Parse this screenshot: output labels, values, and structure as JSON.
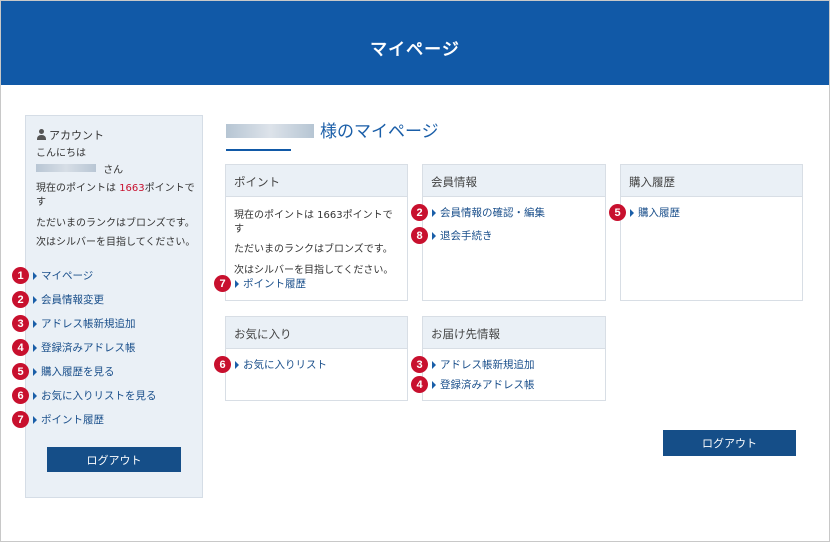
{
  "header": {
    "title": "マイページ"
  },
  "sidebar": {
    "account_label": "アカウント",
    "greeting": "こんにちは",
    "san": "さん",
    "points_prefix": "現在のポイントは ",
    "points_value": "1663",
    "points_suffix": "ポイントで",
    "points_suffix2": "す",
    "rank_text": "ただいまのランクはブロンズです。",
    "next_text": "次はシルバーを目指してください。",
    "links": [
      {
        "num": "1",
        "label": "マイページ"
      },
      {
        "num": "2",
        "label": "会員情報変更"
      },
      {
        "num": "3",
        "label": "アドレス帳新規追加"
      },
      {
        "num": "4",
        "label": "登録済みアドレス帳"
      },
      {
        "num": "5",
        "label": "購入履歴を見る"
      },
      {
        "num": "6",
        "label": "お気に入りリストを見る"
      },
      {
        "num": "7",
        "label": "ポイント履歴"
      }
    ],
    "logout": "ログアウト"
  },
  "main": {
    "title_suffix": "様のマイページ",
    "cards": {
      "points": {
        "heading": "ポイント",
        "line1": "現在のポイントは 1663ポイントで",
        "line2": "す",
        "line3": "ただいまのランクはブロンズです。",
        "line4": "次はシルバーを目指してください。",
        "link": {
          "num": "7",
          "label": "ポイント履歴"
        }
      },
      "member": {
        "heading": "会員情報",
        "links": [
          {
            "num": "2",
            "label": "会員情報の確認・編集"
          },
          {
            "num": "8",
            "label": "退会手続き"
          }
        ]
      },
      "purchase": {
        "heading": "購入履歴",
        "link": {
          "num": "5",
          "label": "購入履歴"
        }
      },
      "favorites": {
        "heading": "お気に入り",
        "link": {
          "num": "6",
          "label": "お気に入りリスト"
        }
      },
      "delivery": {
        "heading": "お届け先情報",
        "links": [
          {
            "num": "3",
            "label": "アドレス帳新規追加"
          },
          {
            "num": "4",
            "label": "登録済みアドレス帳"
          }
        ]
      }
    },
    "logout": "ログアウト"
  },
  "colors": {
    "header": "#1159a7",
    "badge": "#c8102e",
    "button": "#154e88",
    "panel": "#eaf0f6"
  }
}
